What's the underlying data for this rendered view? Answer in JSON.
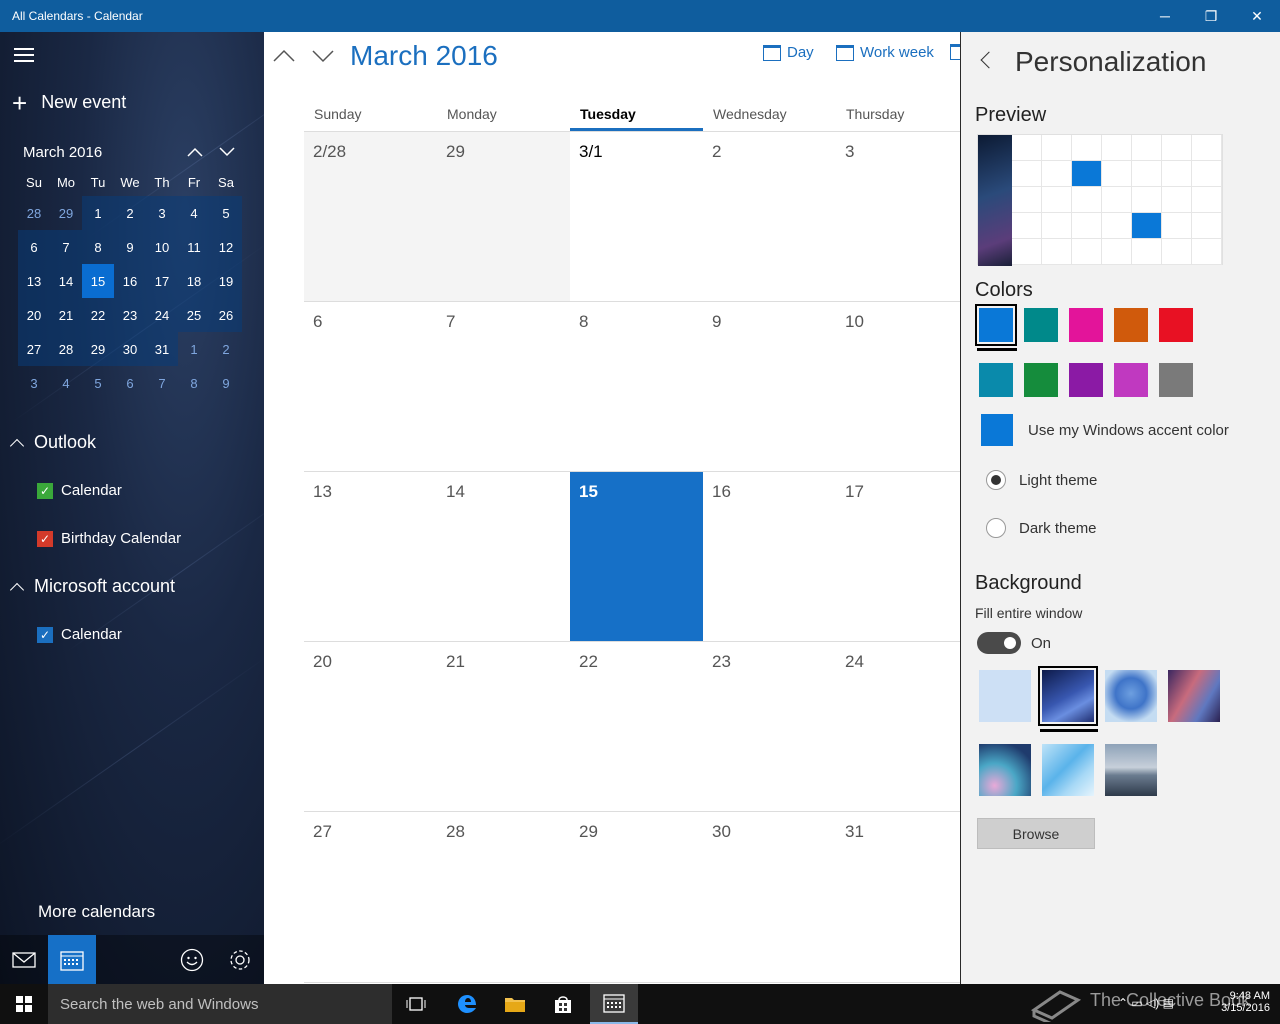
{
  "window": {
    "title": "All Calendars - Calendar",
    "controls": {
      "minimize": "─",
      "restore": "❐",
      "close": "✕"
    }
  },
  "sidebar": {
    "new_event": "New event",
    "mini_calendar": {
      "title": "March 2016",
      "weekdays": [
        "Su",
        "Mo",
        "Tu",
        "We",
        "Th",
        "Fr",
        "Sa"
      ],
      "weeks": [
        [
          "28",
          "29",
          "1",
          "2",
          "3",
          "4",
          "5"
        ],
        [
          "6",
          "7",
          "8",
          "9",
          "10",
          "11",
          "12"
        ],
        [
          "13",
          "14",
          "15",
          "16",
          "17",
          "18",
          "19"
        ],
        [
          "20",
          "21",
          "22",
          "23",
          "24",
          "25",
          "26"
        ],
        [
          "27",
          "28",
          "29",
          "30",
          "31",
          "1",
          "2"
        ],
        [
          "3",
          "4",
          "5",
          "6",
          "7",
          "8",
          "9"
        ]
      ],
      "selected": "15"
    },
    "groups": [
      {
        "name": "Outlook",
        "calendars": [
          {
            "label": "Calendar",
            "checked": true,
            "color": "#3aa83a"
          },
          {
            "label": "Birthday Calendar",
            "checked": true,
            "color": "#d33a2a"
          }
        ]
      },
      {
        "name": "Microsoft account",
        "calendars": [
          {
            "label": "Calendar",
            "checked": true,
            "color": "#1b6fbf"
          }
        ]
      }
    ],
    "more_calendars": "More calendars",
    "bottom_icons": [
      "mail-icon",
      "calendar-icon",
      "smiley-feedback-icon",
      "gear-icon"
    ]
  },
  "main": {
    "month_title": "March 2016",
    "views": [
      "Day",
      "Work week"
    ],
    "day_headers": [
      "Sunday",
      "Monday",
      "Tuesday",
      "Wednesday",
      "Thursday"
    ],
    "today_header": "Tuesday",
    "weeks": [
      [
        "2/28",
        "29",
        "3/1",
        "2",
        "3"
      ],
      [
        "6",
        "7",
        "8",
        "9",
        "10"
      ],
      [
        "13",
        "14",
        "15",
        "16",
        "17"
      ],
      [
        "20",
        "21",
        "22",
        "23",
        "24"
      ],
      [
        "27",
        "28",
        "29",
        "30",
        "31"
      ]
    ],
    "today": "15"
  },
  "personalization": {
    "title": "Personalization",
    "preview_label": "Preview",
    "colors_label": "Colors",
    "colors_row1": [
      "#0a78d7",
      "#00898a",
      "#e3149a",
      "#d05a0c",
      "#e81123"
    ],
    "colors_row2": [
      "#0a8aab",
      "#158c3c",
      "#8b1aa5",
      "#c039c0",
      "#7a7a7a"
    ],
    "selected_color": "#0a78d7",
    "accent_label": "Use my Windows accent color",
    "light_theme": "Light theme",
    "dark_theme": "Dark theme",
    "theme_selected": "light",
    "background_label": "Background",
    "fill_label": "Fill entire window",
    "toggle_state": "On",
    "browse": "Browse"
  },
  "taskbar": {
    "search_placeholder": "Search the web and Windows",
    "time": "9:48 AM",
    "date": "3/15/2016",
    "watermark": "The Collective Book"
  }
}
